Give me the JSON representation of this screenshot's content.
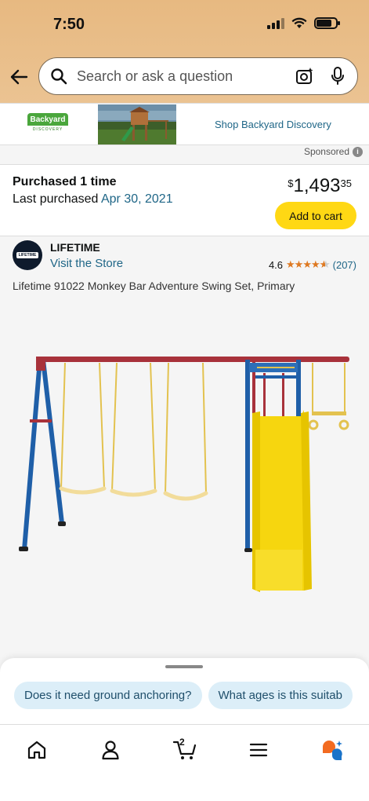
{
  "status_bar": {
    "time": "7:50"
  },
  "search": {
    "placeholder": "Search or ask a question"
  },
  "ad": {
    "brand_logo_text": "Backyard",
    "brand_logo_subtext": "DISCOVERY",
    "link_text": "Shop Backyard Discovery",
    "sponsored_label": "Sponsored"
  },
  "purchase": {
    "purchased_label": "Purchased 1 time",
    "last_purchased_prefix": "Last purchased",
    "last_purchased_date": "Apr 30, 2021",
    "price_symbol": "$",
    "price_whole": "1,493",
    "price_cents": "35",
    "add_to_cart_label": "Add to cart"
  },
  "product": {
    "brand_logo_text": "LIFETIME",
    "brand_name": "LIFETIME",
    "visit_store_label": "Visit the Store",
    "rating_value": "4.6",
    "rating_fraction": 0.92,
    "rating_count": "(207)",
    "title": "Lifetime 91022 Monkey Bar Adventure Swing Set, Primary"
  },
  "suggestions": [
    "Does it need ground anchoring?",
    "What ages is this suitab"
  ],
  "nav": {
    "cart_count": "2"
  },
  "colors": {
    "header_bg": "#e7b981",
    "link": "#1f6687",
    "add_to_cart": "#ffd814",
    "star": "#de7921",
    "chip_bg": "#dceef8"
  },
  "icons": [
    "back-arrow-icon",
    "search-icon",
    "camera-icon",
    "mic-icon",
    "info-icon",
    "home-icon",
    "account-icon",
    "cart-icon",
    "menu-icon",
    "assistant-icon"
  ]
}
